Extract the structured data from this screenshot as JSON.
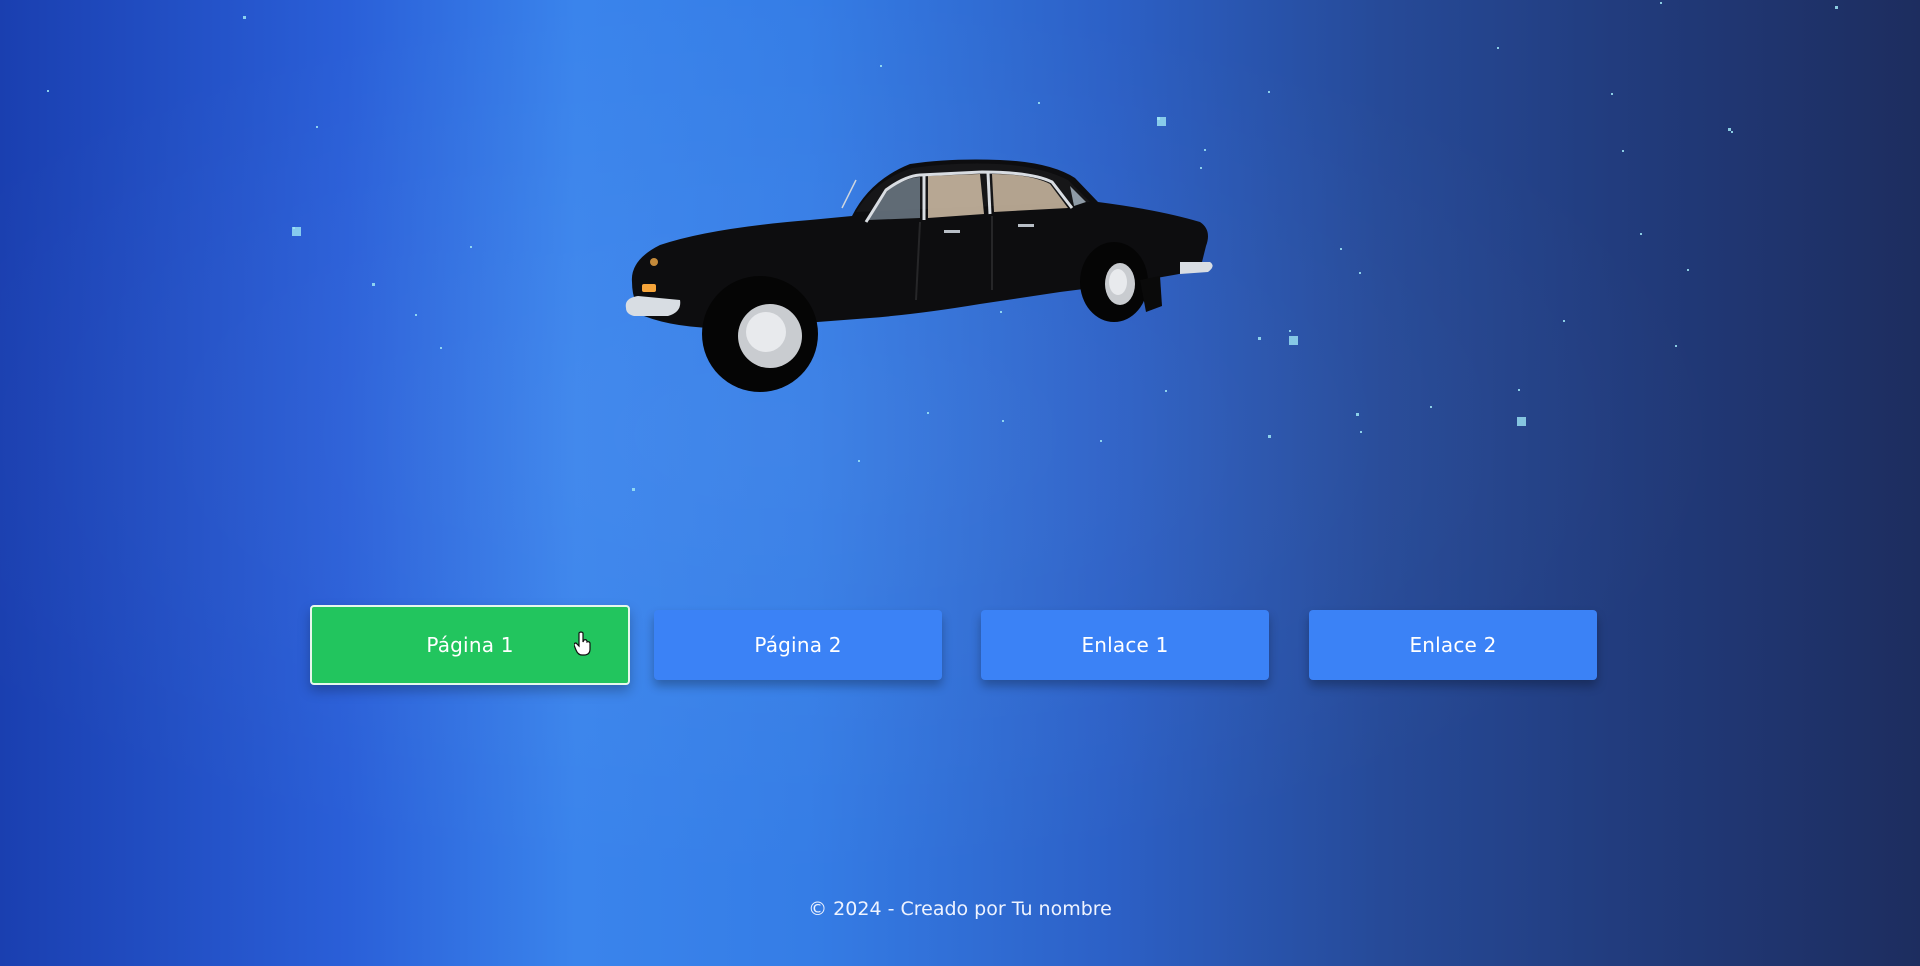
{
  "nav": {
    "buttons": [
      {
        "label": "Página 1",
        "active": true
      },
      {
        "label": "Página 2",
        "active": false
      },
      {
        "label": "Enlace 1",
        "active": false
      },
      {
        "label": "Enlace 2",
        "active": false
      }
    ]
  },
  "footer": {
    "text": "© 2024 - Creado por Tu nombre"
  },
  "scene": {
    "object": "car-3d-model",
    "car_color": "#111111"
  },
  "colors": {
    "active_button": "#22c55e",
    "button": "#3b82f6",
    "star": "#9ee6f5"
  }
}
